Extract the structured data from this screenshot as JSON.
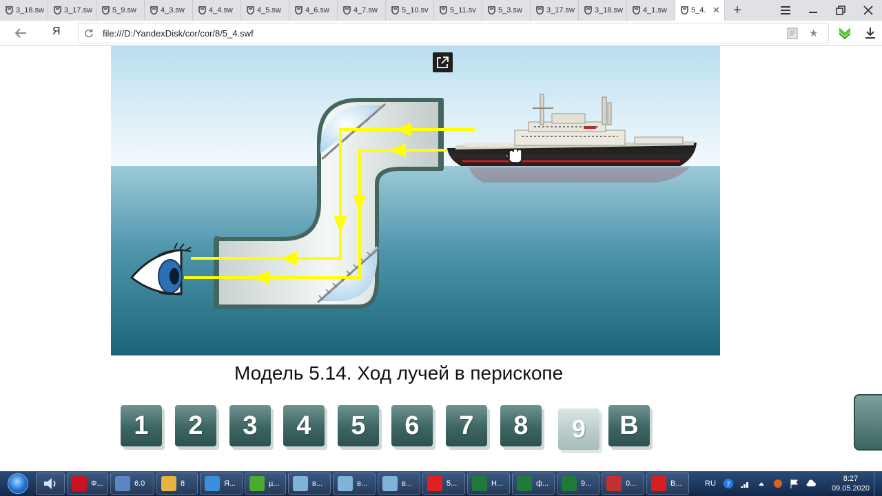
{
  "browser": {
    "tabs": [
      {
        "label": "3_18.sw"
      },
      {
        "label": "3_17.sw"
      },
      {
        "label": "5_9.sw"
      },
      {
        "label": "4_3.sw"
      },
      {
        "label": "4_4.sw"
      },
      {
        "label": "4_5.sw"
      },
      {
        "label": "4_6.sw"
      },
      {
        "label": "4_7.sw"
      },
      {
        "label": "5_10.sv"
      },
      {
        "label": "5_11.sv"
      },
      {
        "label": "5_3.sw"
      },
      {
        "label": "3_17.sw"
      },
      {
        "label": "3_18.sw"
      },
      {
        "label": "4_1.sw"
      }
    ],
    "active_tab": {
      "label": "5_4."
    },
    "logo": "Я",
    "url": "file:///D:/YandexDisk/cor/cor/8/5_4.swf"
  },
  "model": {
    "caption": "Модель 5.14. Ход лучей в перископе",
    "buttons": [
      "1",
      "2",
      "3",
      "4",
      "5",
      "6",
      "7",
      "8",
      "9",
      "B"
    ],
    "selected_button": "9"
  },
  "taskbar": {
    "items": [
      {
        "label": "Ф...",
        "color": "#c8141e"
      },
      {
        "label": "6.0",
        "color": "#5b86c4"
      },
      {
        "label": "8",
        "color": "#e8b440"
      },
      {
        "label": "Я...",
        "color": "#3a8fd8"
      },
      {
        "label": "µ...",
        "color": "#4caa2f"
      },
      {
        "label": "в...",
        "color": "#7fb3d9"
      },
      {
        "label": "в...",
        "color": "#7fb3d9"
      },
      {
        "label": "в...",
        "color": "#7fb3d9"
      },
      {
        "label": "5...",
        "color": "#e02020"
      },
      {
        "label": "Н...",
        "color": "#1f7a3a"
      },
      {
        "label": "ф...",
        "color": "#1f7a3a"
      },
      {
        "label": "9...",
        "color": "#1f7a3a"
      },
      {
        "label": "0...",
        "color": "#c23030"
      },
      {
        "label": "В...",
        "color": "#d81f1f"
      }
    ],
    "lang": "RU",
    "time": "8:27",
    "date": "09.05.2020"
  },
  "colors": {
    "sky": "#eef6fb",
    "water_top": "#7fb6c9",
    "water_bottom": "#1d6a80",
    "ray": "#ffff00",
    "periscope_frame": "#45665f",
    "button_face": "#3c6561"
  }
}
